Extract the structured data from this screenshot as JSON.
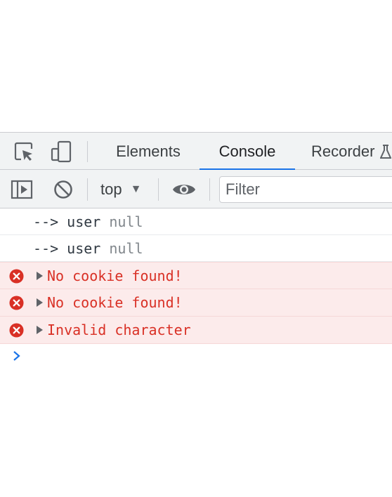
{
  "tabs": [
    {
      "label": "Elements",
      "active": false
    },
    {
      "label": "Console",
      "active": true
    },
    {
      "label": "Recorder",
      "active": false
    }
  ],
  "toolbar": {
    "context": "top",
    "filter_placeholder": "Filter"
  },
  "console": {
    "logs": [
      {
        "prefix": "--> user",
        "value": "null"
      },
      {
        "prefix": "--> user",
        "value": "null"
      }
    ],
    "errors": [
      {
        "text": "No cookie found!"
      },
      {
        "text": "No cookie found!"
      },
      {
        "text": "Invalid character"
      }
    ]
  },
  "colors": {
    "accent": "#1a73e8",
    "error_text": "#d93025",
    "error_bg": "#fcebeb",
    "error_icon": "#d93025",
    "toolbar_bg": "#f1f3f4",
    "prompt": "#1a73e8"
  },
  "icons": [
    "inspect-element-icon",
    "device-toolbar-icon",
    "sidebar-toggle-icon",
    "clear-console-icon",
    "eye-icon",
    "error-icon",
    "prompt-chevron-icon",
    "expand-triangle-icon"
  ]
}
